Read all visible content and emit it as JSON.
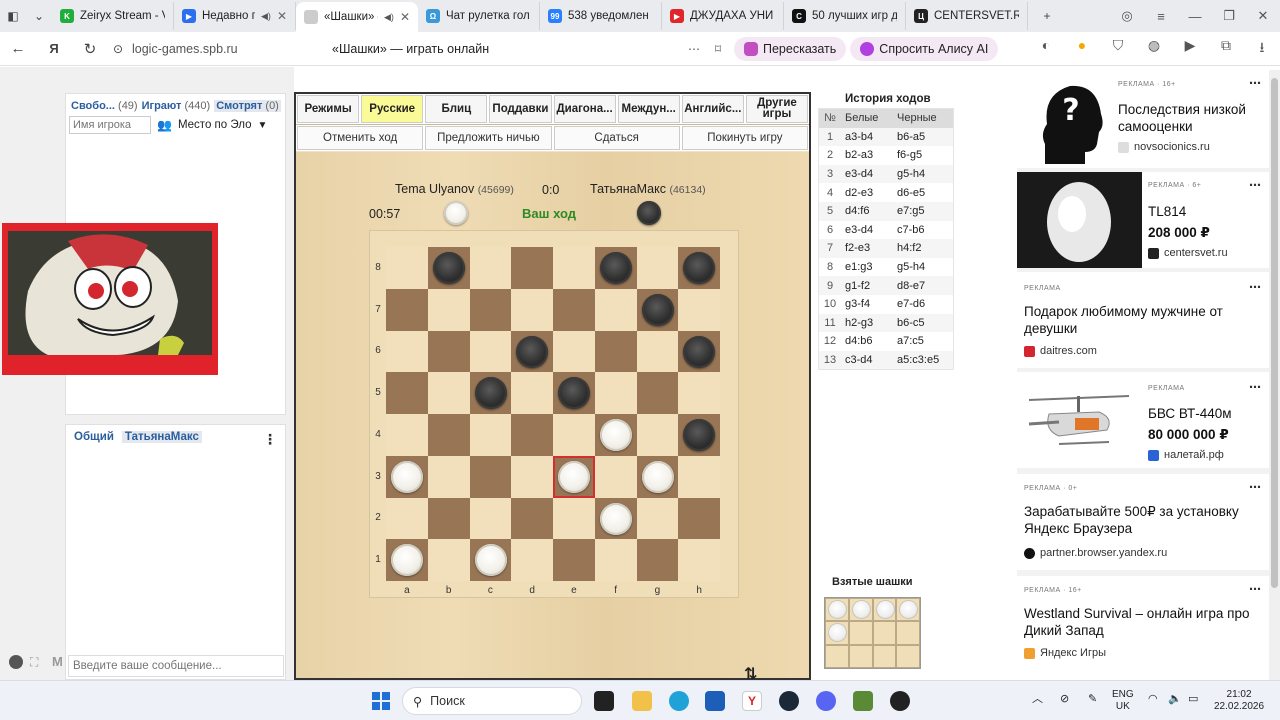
{
  "browser": {
    "tabs": [
      {
        "title": "Zeiryx Stream - V",
        "color": "#1fae3b",
        "glyph": "K"
      },
      {
        "title": "Недавно пр",
        "color": "#2b6ff0",
        "glyph": "▶",
        "audio": true
      },
      {
        "title": "«Шашки» –",
        "color": "#cccccc",
        "glyph": "",
        "audio": true,
        "active": true
      },
      {
        "title": "Чат рулетка гол",
        "color": "#3a9ad9",
        "glyph": "Ω"
      },
      {
        "title": "538 уведомлен",
        "color": "#2980ff",
        "glyph": "99"
      },
      {
        "title": "ДЖУДАХА УНИ",
        "color": "#e0262a",
        "glyph": "▶"
      },
      {
        "title": "50 лучших игр д",
        "color": "#111111",
        "glyph": "C"
      },
      {
        "title": "CENTERSVET.R",
        "color": "#222222",
        "glyph": "Ц"
      }
    ],
    "url": "logic-games.spb.ru",
    "page_title": "«Шашки» — играть онлайн",
    "retell_label": "Пересказать",
    "alice_label": "Спросить Алису AI"
  },
  "players_panel": {
    "tabs": [
      {
        "label": "Свобо...",
        "count": "(49)"
      },
      {
        "label": "Играют",
        "count": "(440)"
      },
      {
        "label": "Смотрят",
        "count": "(0)"
      }
    ],
    "search_placeholder": "Имя игрока",
    "sort_label": "Место по Эло"
  },
  "chat": {
    "tabs": [
      "Общий",
      "ТатьянаМакс"
    ],
    "input_placeholder": "Введите ваше сообщение..."
  },
  "stream": {
    "name": "Zeiryx"
  },
  "game": {
    "modes": [
      "Режимы",
      "Русские",
      "Блиц",
      "Поддавки",
      "Диагона...",
      "Междун...",
      "Англи­йс...",
      "Другие игры"
    ],
    "selected_mode": "Русские",
    "actions": [
      "Отменить ход",
      "Предложить ничью",
      "Сдаться",
      "Покинуть игру"
    ],
    "player_white": {
      "name": "Tema Ulyanov",
      "rating": "(45699)"
    },
    "player_black": {
      "name": "ТатьянаМакс",
      "rating": "(46134)"
    },
    "score": "0:0",
    "timer": "00:57",
    "turn_text": "Ваш ход",
    "ranks": [
      "8",
      "7",
      "6",
      "5",
      "4",
      "3",
      "2",
      "1"
    ],
    "files": [
      "a",
      "b",
      "c",
      "d",
      "e",
      "f",
      "g",
      "h"
    ],
    "black_pieces": [
      "b8",
      "f8",
      "h8",
      "g7",
      "d6",
      "h6",
      "c5",
      "e5",
      "h4"
    ],
    "white_pieces": [
      "f4",
      "a3",
      "e3",
      "g3",
      "f2",
      "a1",
      "c1"
    ],
    "highlighted": "e3"
  },
  "history": {
    "title": "История ходов",
    "headers": [
      "№",
      "Белые",
      "Черные"
    ],
    "moves": [
      [
        "1",
        "a3-b4",
        "b6-a5"
      ],
      [
        "2",
        "b2-a3",
        "f6-g5"
      ],
      [
        "3",
        "e3-d4",
        "g5-h4"
      ],
      [
        "4",
        "d2-e3",
        "d6-e5"
      ],
      [
        "5",
        "d4:f6",
        "e7:g5"
      ],
      [
        "6",
        "e3-d4",
        "c7-b6"
      ],
      [
        "7",
        "f2-e3",
        "h4:f2"
      ],
      [
        "8",
        "e1:g3",
        "g5-h4"
      ],
      [
        "9",
        "g1-f2",
        "d8-e7"
      ],
      [
        "10",
        "g3-f4",
        "e7-d6"
      ],
      [
        "11",
        "h2-g3",
        "b6-c5"
      ],
      [
        "12",
        "d4:b6",
        "a7:c5"
      ],
      [
        "13",
        "c3-d4",
        "a5:c3:e5"
      ]
    ]
  },
  "captured": {
    "title": "Взятые шашки",
    "count": 5
  },
  "ads": [
    {
      "label": "РЕКЛАМА · 16+",
      "title": "Последствия низкой самооценки",
      "domain": "novsocionics.ru",
      "price": ""
    },
    {
      "label": "РЕКЛАМА · 6+",
      "title": "TL814",
      "price": "208 000 ₽",
      "domain": "centersvet.ru"
    },
    {
      "label": "РЕКЛАМА",
      "title": "Подарок любимому мужчине от девушки",
      "domain": "daitres.com",
      "price": ""
    },
    {
      "label": "РЕКЛАМА",
      "title": "БВС ВТ-440м",
      "price": "80 000 000 ₽",
      "domain": "налетай.рф"
    },
    {
      "label": "РЕКЛАМА · 0+",
      "title": "Зарабатывайте 500₽ за установку Яндекс Браузера",
      "domain": "partner.browser.yandex.ru",
      "price": ""
    },
    {
      "label": "РЕКЛАМА · 16+",
      "title": "Westland Survival – онлайн игра про Дикий Запад",
      "domain": "Яндекс Игры",
      "price": ""
    }
  ],
  "taskbar": {
    "search_label": "Поиск",
    "lang_line1": "ENG",
    "lang_line2": "UK",
    "time": "21:02",
    "date": "22.02.2026"
  }
}
